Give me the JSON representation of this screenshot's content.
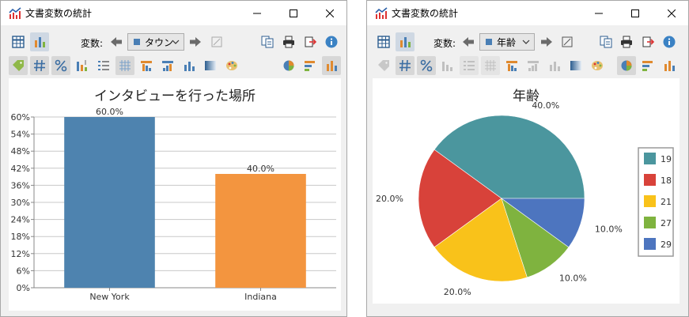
{
  "windows": [
    {
      "title": "文書変数の統計",
      "variable_label": "変数:",
      "variable_value": "タウン",
      "chart_title": "インタビューを行った場所"
    },
    {
      "title": "文書変数の統計",
      "variable_label": "変数:",
      "variable_value": "年齢",
      "chart_title": "年齢"
    }
  ],
  "colors": {
    "accent_blue": "#4a7fb5",
    "window_bg": "#f0f0f0",
    "selected_tool": "#cfd8e3"
  },
  "icons": [
    "chart-app-icon",
    "minimize-icon",
    "maximize-icon",
    "close-icon",
    "table-view-icon",
    "chart-view-icon",
    "arrow-left-icon",
    "arrow-right-icon",
    "empty-set-icon",
    "copy-icon",
    "print-icon",
    "export-icon",
    "info-icon",
    "tag-icon",
    "hash-icon",
    "percent-icon",
    "sort-icon",
    "list-icon",
    "grid-icon",
    "bar-desc-icon",
    "bar-asc-icon",
    "bar-chart-icon",
    "gradient-icon",
    "palette-icon",
    "pie-icon",
    "horizontal-bar-icon"
  ],
  "chart_data": [
    {
      "type": "bar",
      "title": "インタビューを行った場所",
      "categories": [
        "New York",
        "Indiana"
      ],
      "values": [
        60.0,
        40.0
      ],
      "value_labels": [
        "60.0%",
        "40.0%"
      ],
      "colors": [
        "#4e83af",
        "#f3953f"
      ],
      "ylim": [
        0,
        60
      ],
      "yticks": [
        "0%",
        "6%",
        "12%",
        "18%",
        "24%",
        "30%",
        "36%",
        "42%",
        "48%",
        "54%",
        "60%"
      ],
      "grid": true
    },
    {
      "type": "pie",
      "title": "年齢",
      "labels": [
        "19",
        "18",
        "21",
        "27",
        "29"
      ],
      "values": [
        40.0,
        20.0,
        20.0,
        10.0,
        10.0
      ],
      "value_labels": [
        "40.0%",
        "20.0%",
        "20.0%",
        "10.0%",
        "10.0%"
      ],
      "colors": [
        "#4b969e",
        "#d8423a",
        "#f9c21a",
        "#7fb33f",
        "#4d75bf"
      ],
      "legend": "right"
    }
  ]
}
